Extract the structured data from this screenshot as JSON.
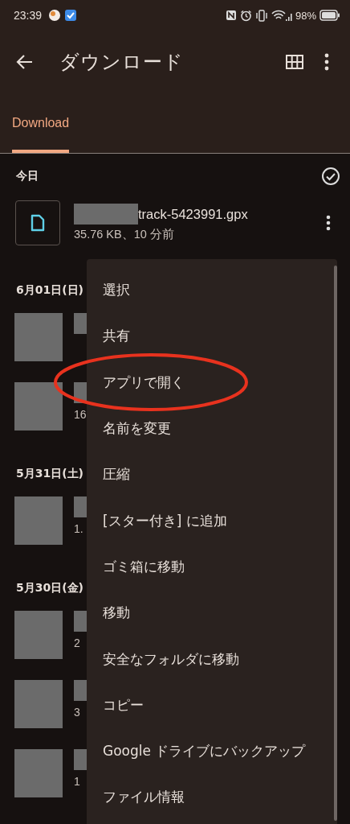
{
  "status_bar": {
    "time": "23:39",
    "battery": "98%"
  },
  "app_bar": {
    "title": "ダウンロード"
  },
  "tabs": [
    {
      "label": "Download",
      "selected": true
    }
  ],
  "sections": [
    {
      "heading": "今日",
      "select_all": true,
      "files": [
        {
          "kind": "file",
          "name": "track-5423991.gpx",
          "meta": "35.76 KB、10 分前"
        }
      ]
    },
    {
      "heading": "6月01日(日)",
      "files": [
        {
          "kind": "thumb"
        },
        {
          "kind": "thumb",
          "meta": "16"
        }
      ]
    },
    {
      "heading": "5月31日(土)",
      "files": [
        {
          "kind": "thumb",
          "meta": "1."
        }
      ]
    },
    {
      "heading": "5月30日(金)",
      "files": [
        {
          "kind": "thumb",
          "meta": "2"
        },
        {
          "kind": "thumb",
          "meta": "3"
        },
        {
          "kind": "thumb",
          "meta": "1"
        }
      ]
    }
  ],
  "menu": {
    "items": [
      {
        "label": "選択",
        "circled": false
      },
      {
        "label": "共有",
        "circled": false
      },
      {
        "label": "アプリで開く",
        "circled": true
      },
      {
        "label": "名前を変更",
        "circled": false
      },
      {
        "label": "圧縮",
        "circled": false
      },
      {
        "label": "[スター付き] に追加",
        "circled": false
      },
      {
        "label": "ゴミ箱に移動",
        "circled": false
      },
      {
        "label": "移動",
        "circled": false
      },
      {
        "label": "安全なフォルダに移動",
        "circled": false
      },
      {
        "label": "コピー",
        "circled": false
      },
      {
        "label": "Google ドライブにバックアップ",
        "circled": false
      },
      {
        "label": "ファイル情報",
        "circled": false
      }
    ]
  }
}
